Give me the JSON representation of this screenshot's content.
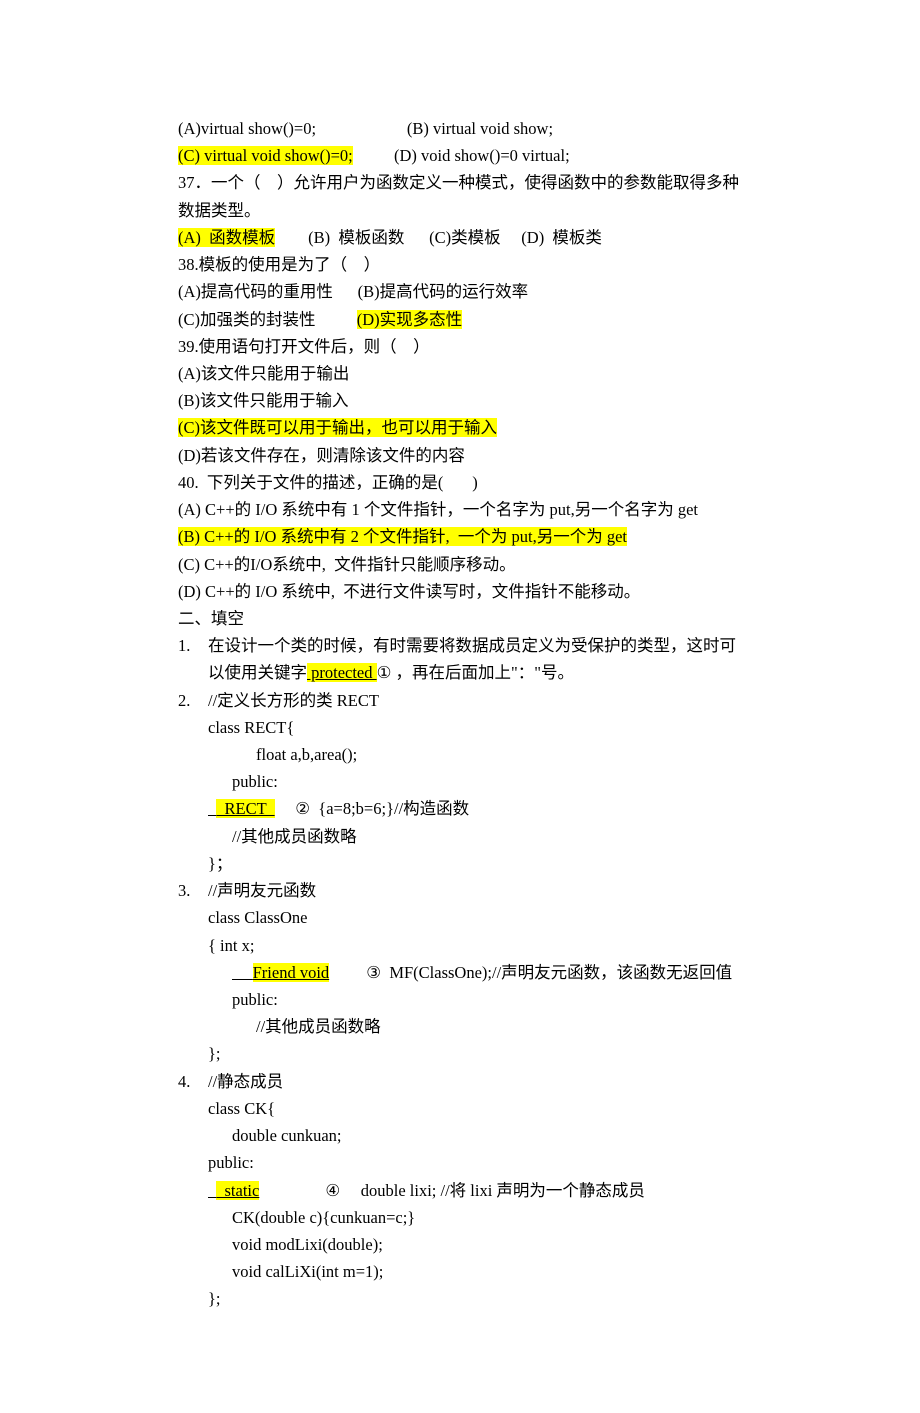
{
  "q36": {
    "a": "(A)virtual show()=0;",
    "b": "(B) virtual void show;",
    "c": "(C) virtual void show()=0;",
    "d": "(D) void show()=0 virtual;"
  },
  "q37": {
    "stem": "37．一个（    ）允许用户为函数定义一种模式，使得函数中的参数能取得多种数据类型。",
    "a": "(A)  函数模板",
    "b": "(B)  模板函数",
    "c": "(C)类模板",
    "d": "(D)  模板类"
  },
  "q38": {
    "stem": "38.模板的使用是为了（    ）",
    "a": "(A)提高代码的重用性",
    "b": "(B)提高代码的运行效率",
    "c": "(C)加强类的封装性",
    "d": "(D)实现多态性"
  },
  "q39": {
    "stem": "39.使用语句打开文件后，则（    ）",
    "a": "(A)该文件只能用于输出",
    "b": "(B)该文件只能用于输入",
    "c": "(C)该文件既可以用于输出，也可以用于输入",
    "d": "(D)若该文件存在，则清除该文件的内容"
  },
  "q40": {
    "stem": "40.  下列关于文件的描述，正确的是(       )",
    "a": "(A) C++的 I/O 系统中有 1 个文件指针，一个名字为 put,另一个名字为 get",
    "b": "(B) C++的 I/O 系统中有 2 个文件指针,  一个为 put,另一个为 get",
    "c": "(C) C++的I/O系统中,  文件指针只能顺序移动。",
    "d": "(D) C++的 I/O 系统中,  不进行文件读写时，文件指针不能移动。"
  },
  "section2": "二、填空",
  "f1": {
    "num": "1.",
    "line1_a": "在设计一个类的时候，有时需要将数据成员定义为受保护的类型，这时可以使用关键字",
    "blank": "   protected            ",
    "line1_b": "①  ，再在后面加上\"：",
    "line1_c": "\"号。"
  },
  "f2": {
    "num": "2.",
    "l1": "//定义长方形的类 RECT",
    "l2": "class RECT{",
    "l3": "float a,b,area();",
    "l4": "public:",
    "blank_pre": "  ",
    "blank": "  RECT  ",
    "l5": "     ②  {a=8;b=6;}//构造函数",
    "l6": "//其他成员函数略",
    "l7": "}；"
  },
  "f3": {
    "num": "3.",
    "l1": "//声明友元函数",
    "l2": "class ClassOne",
    "l3": "{ int x;",
    "blank_pre": "     ",
    "blank": "Friend void",
    "l4": "         ③  MF(ClassOne);//声明友元函数，该函数无返回值",
    "l5": "public:",
    "l6": "//其他成员函数略",
    "l7": "};"
  },
  "f4": {
    "num": "4.",
    "l1": "//静态成员",
    "l2": "class CK{",
    "l3": "double cunkuan;",
    "l4": "public:",
    "blank_pre": "  ",
    "blank": "  static",
    "l5": "                ④     double lixi; //将 lixi 声明为一个静态成员",
    "l6": "CK(double c){cunkuan=c;}",
    "l7": "void modLixi(double);",
    "l8": "void calLiXi(int m=1);",
    "l9": "};"
  }
}
